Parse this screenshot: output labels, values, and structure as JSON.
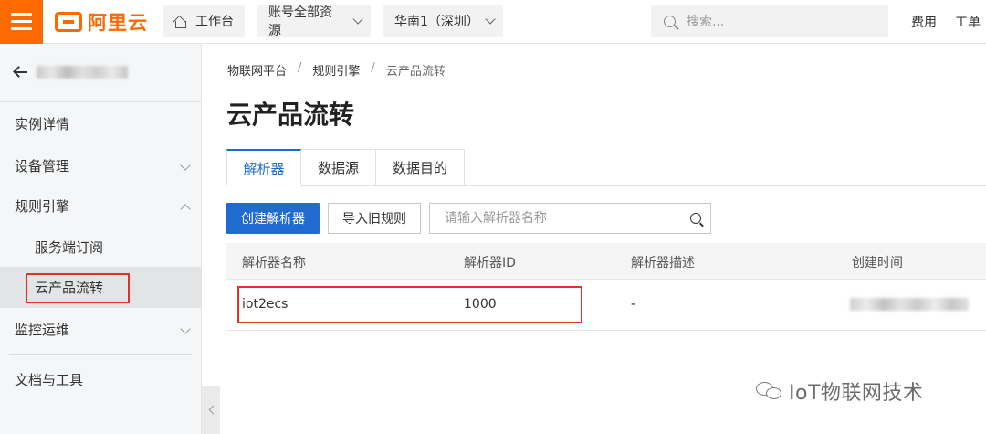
{
  "header": {
    "logo_text": "阿里云",
    "workbench": "工作台",
    "resources": "账号全部资源",
    "region": "华南1（深圳）",
    "search_placeholder": "搜索...",
    "links": [
      "费用",
      "工单"
    ],
    "brand_color": "#ff6a00"
  },
  "sidebar": {
    "items": [
      {
        "label": "实例详情"
      },
      {
        "label": "设备管理"
      },
      {
        "label": "规则引擎"
      },
      {
        "label": "服务端订阅"
      },
      {
        "label": "云产品流转"
      },
      {
        "label": "监控运维"
      },
      {
        "label": "文档与工具"
      }
    ]
  },
  "breadcrumb": [
    "物联网平台",
    "规则引擎",
    "云产品流转"
  ],
  "page_title": "云产品流转",
  "tabs": [
    {
      "label": "解析器",
      "active": true
    },
    {
      "label": "数据源"
    },
    {
      "label": "数据目的"
    }
  ],
  "toolbar": {
    "create_label": "创建解析器",
    "import_label": "导入旧规则",
    "filter_placeholder": "请输入解析器名称"
  },
  "table": {
    "columns": [
      "解析器名称",
      "解析器ID",
      "解析器描述",
      "创建时间"
    ],
    "rows": [
      {
        "name": "iot2ecs",
        "id": "1000",
        "desc": "-"
      }
    ]
  },
  "watermark": "IoT物联网技术",
  "accent_color": "#1f6bd1",
  "highlight_color": "#e0312b"
}
